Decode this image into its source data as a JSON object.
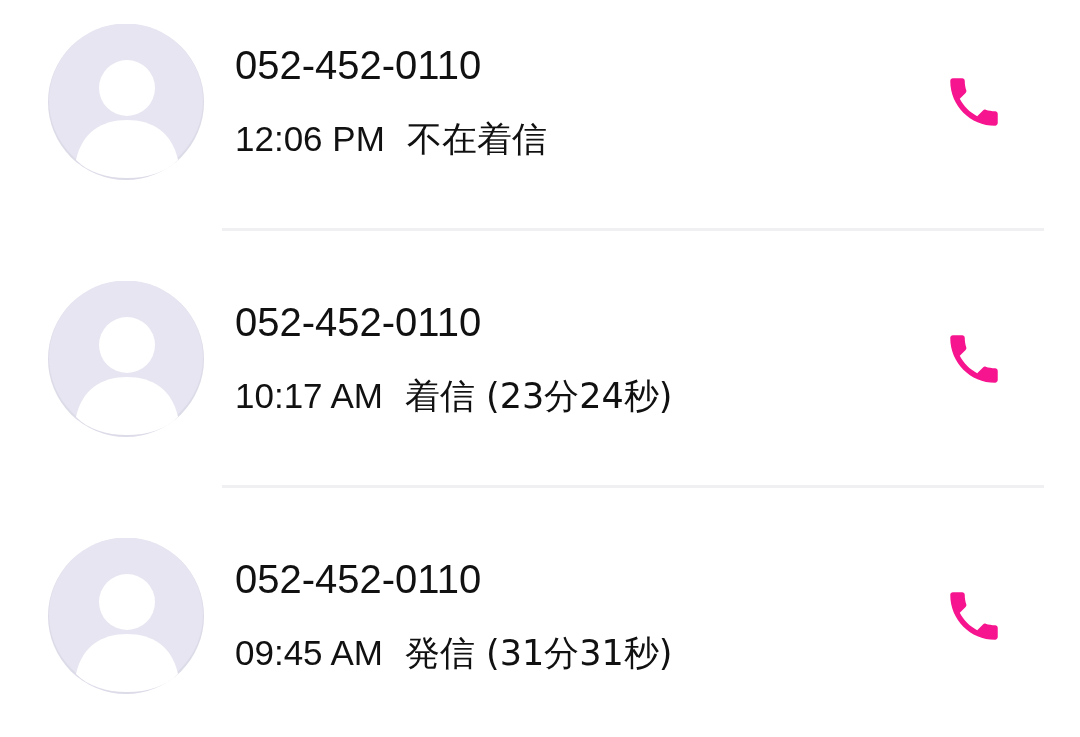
{
  "calls": [
    {
      "number": "052-452-0110",
      "time": "12:06 PM",
      "detail": "不在着信"
    },
    {
      "number": "052-452-0110",
      "time": "10:17 AM",
      "detail": "着信 (23分24秒)"
    },
    {
      "number": "052-452-0110",
      "time": "09:45 AM",
      "detail": "発信 (31分31秒)"
    }
  ]
}
